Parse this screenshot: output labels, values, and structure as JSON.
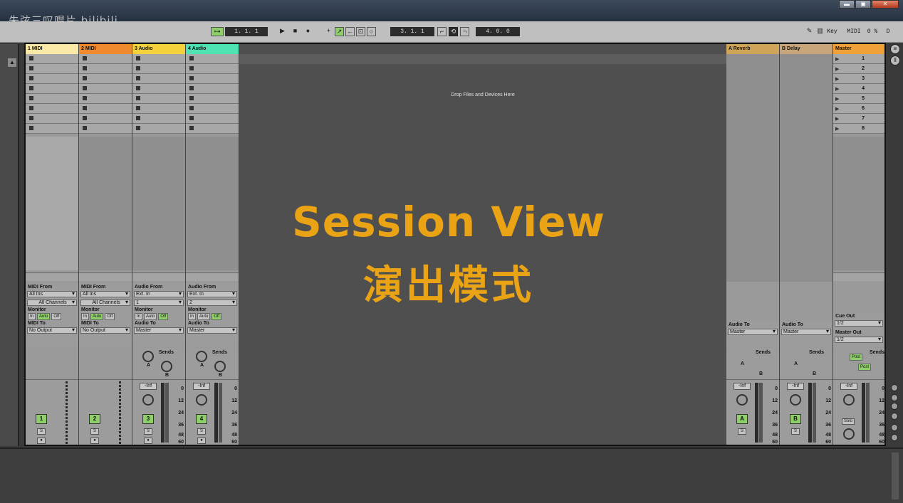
{
  "watermark": "朱弦三叹唱片 bilibili",
  "window_controls": {
    "min": "▬",
    "max": "▣",
    "close": "✕"
  },
  "transport": {
    "arrangement_position": "1.  1.  1",
    "loop_start": "3.  1.  1",
    "loop_length": "4.  0.  0",
    "key_label": "Key",
    "midi_label": "MIDI",
    "cpu": "0 %",
    "d_label": "D"
  },
  "tracks": [
    {
      "name": "1 MIDI",
      "color": "#f9e8a6",
      "io_from_label": "MIDI From",
      "from": "All Ins",
      "channel": "All Channels",
      "to_label": "MIDI To",
      "to": "No Output",
      "number": "1"
    },
    {
      "name": "2 MIDI",
      "color": "#f08a2e",
      "io_from_label": "MIDI From",
      "from": "All Ins",
      "channel": "All Channels",
      "to_label": "MIDI To",
      "to": "No Output",
      "number": "2"
    },
    {
      "name": "3 Audio",
      "color": "#f4d23c",
      "io_from_label": "Audio From",
      "from": "Ext. In",
      "channel": "1",
      "to_label": "Audio To",
      "to": "Master",
      "number": "3",
      "volume": "-Inf"
    },
    {
      "name": "4 Audio",
      "color": "#4fe3b4",
      "io_from_label": "Audio From",
      "from": "Ext. In",
      "channel": "2",
      "to_label": "Audio To",
      "to": "Master",
      "number": "4",
      "volume": "-Inf"
    }
  ],
  "monitor": {
    "label": "Monitor",
    "in": "In",
    "auto": "Auto",
    "off": "Off"
  },
  "sends": {
    "label": "Sends",
    "a": "A",
    "b": "B"
  },
  "meter_scale": [
    "0",
    "12",
    "24",
    "36",
    "48",
    "60"
  ],
  "solo_label": "S",
  "drop_text": "Drop Files and Devices Here",
  "overlay": {
    "line1": "Session View",
    "line2": "演出模式"
  },
  "returns": [
    {
      "name": "A Reverb",
      "color": "#d0a55a",
      "to_label": "Audio To",
      "to": "Master",
      "letter": "A",
      "volume": "-Inf"
    },
    {
      "name": "B Delay",
      "color": "#c9a57a",
      "to_label": "Audio To",
      "to": "Master",
      "letter": "B",
      "volume": "-Inf"
    }
  ],
  "master": {
    "name": "Master",
    "color": "#f0a13a",
    "scenes": [
      "1",
      "2",
      "3",
      "4",
      "5",
      "6",
      "7",
      "8"
    ],
    "cue_out_label": "Cue Out",
    "cue_out": "1/2",
    "master_out_label": "Master Out",
    "master_out": "1/2",
    "post1": "Post",
    "post2": "Post",
    "volume": "-Inf",
    "solo": "Solo"
  }
}
